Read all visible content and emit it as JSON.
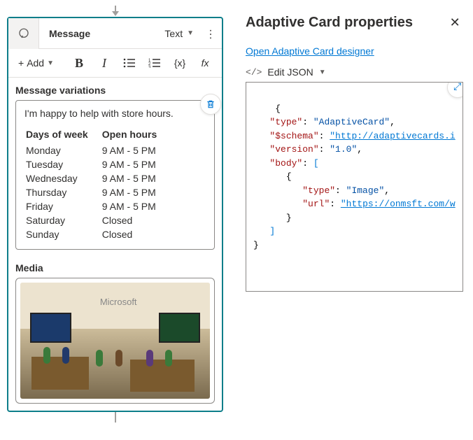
{
  "left": {
    "header": {
      "title": "Message",
      "type_label": "Text"
    },
    "toolbar": {
      "add_label": "Add",
      "bold": "B",
      "italic": "I",
      "var_label": "{x}",
      "fx_label": "fx"
    },
    "variations_title": "Message variations",
    "message": {
      "intro": "I'm happy to help with store hours.",
      "col1": "Days of week",
      "col2": "Open hours",
      "rows": [
        {
          "day": "Monday",
          "hours": "9 AM - 5 PM"
        },
        {
          "day": "Tuesday",
          "hours": "9 AM - 5 PM"
        },
        {
          "day": "Wednesday",
          "hours": "9 AM - 5 PM"
        },
        {
          "day": "Thursday",
          "hours": "9 AM - 5 PM"
        },
        {
          "day": "Friday",
          "hours": "9 AM - 5 PM"
        },
        {
          "day": "Saturday",
          "hours": "Closed"
        },
        {
          "day": "Sunday",
          "hours": "Closed"
        }
      ]
    },
    "media_title": "Media",
    "media_alt": "Microsoft"
  },
  "right": {
    "title": "Adaptive Card properties",
    "designer_link": "Open Adaptive Card designer",
    "edit_json_label": "Edit JSON",
    "json_icon": "</>",
    "json": {
      "k_type": "\"type\"",
      "v_type": "\"AdaptiveCard\"",
      "k_schema": "\"$schema\"",
      "v_schema": "\"http://adaptivecards.i",
      "k_version": "\"version\"",
      "v_version": "\"1.0\"",
      "k_body": "\"body\"",
      "k_btype": "\"type\"",
      "v_btype": "\"Image\"",
      "k_url": "\"url\"",
      "v_url": "\"https://onmsft.com/w"
    }
  }
}
